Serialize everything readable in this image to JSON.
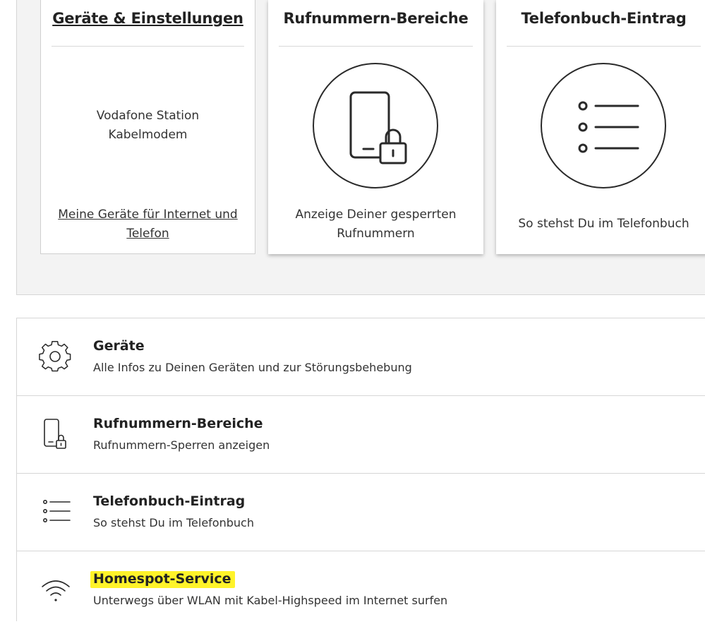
{
  "cards": [
    {
      "title": "Geräte & Einstellungen",
      "text": "Vodafone Station\nKabelmodem",
      "link": "Meine Geräte für Internet und\nTelefon"
    },
    {
      "title": "Rufnummern-Bereiche",
      "text": "Anzeige Deiner gesperrten\nRufnummern",
      "icon": "phone-lock-icon"
    },
    {
      "title": "Telefonbuch-Eintrag",
      "text": "So stehst Du im Telefonbuch",
      "icon": "list-icon"
    }
  ],
  "list": [
    {
      "title": "Geräte",
      "subtitle": "Alle Infos zu Deinen Geräten und zur Störungsbehebung",
      "icon": "gear-icon"
    },
    {
      "title": "Rufnummern-Bereiche",
      "subtitle": "Rufnummern-Sperren anzeigen",
      "icon": "phone-lock-icon"
    },
    {
      "title": "Telefonbuch-Eintrag",
      "subtitle": "So stehst Du im Telefonbuch",
      "icon": "list-icon"
    },
    {
      "title": "Homespot-Service",
      "subtitle": "Unterwegs über WLAN mit Kabel-Highspeed im Internet surfen",
      "icon": "wifi-icon"
    }
  ],
  "colors": {
    "highlight": "#fff32a",
    "panel_bg": "#f3f3f3"
  }
}
